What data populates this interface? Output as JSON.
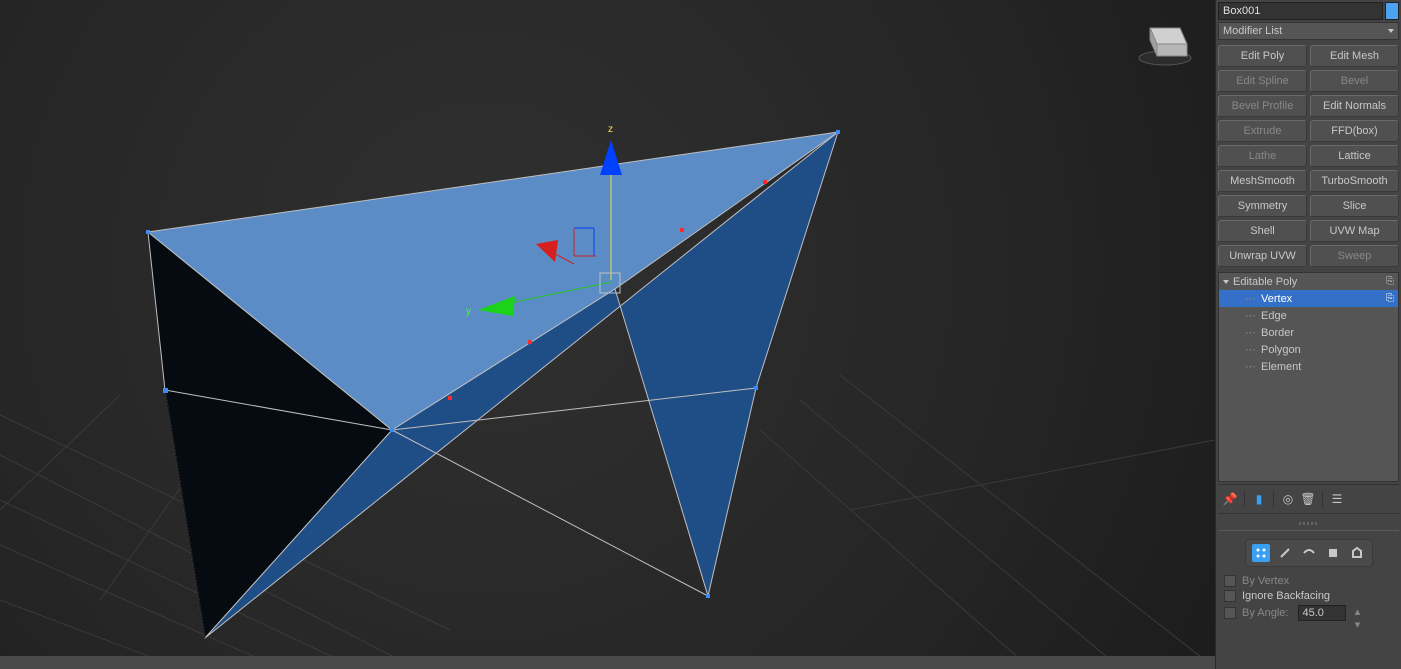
{
  "object_name": "Box001",
  "modifier_list_label": "Modifier List",
  "modifier_buttons": [
    [
      "Edit Poly",
      "Edit Mesh"
    ],
    [
      "Edit Spline",
      "Bevel"
    ],
    [
      "Bevel Profile",
      "Edit Normals"
    ],
    [
      "Extrude",
      "FFD(box)"
    ],
    [
      "Lathe",
      "Lattice"
    ],
    [
      "MeshSmooth",
      "TurboSmooth"
    ],
    [
      "Symmetry",
      "Slice"
    ],
    [
      "Shell",
      "UVW Map"
    ],
    [
      "Unwrap UVW",
      "Sweep"
    ]
  ],
  "disabled_buttons": [
    "Edit Spline",
    "Bevel",
    "Bevel Profile",
    "Extrude",
    "Lathe",
    "Sweep"
  ],
  "stack": {
    "root": "Editable Poly",
    "sub": [
      "Vertex",
      "Edge",
      "Border",
      "Polygon",
      "Element"
    ],
    "selected": "Vertex"
  },
  "selection": {
    "by_vertex": "By Vertex",
    "ignore_backfacing": "Ignore Backfacing",
    "by_angle": "By Angle:",
    "angle_value": "45.0"
  },
  "axes": {
    "z": "z",
    "y": "y"
  }
}
